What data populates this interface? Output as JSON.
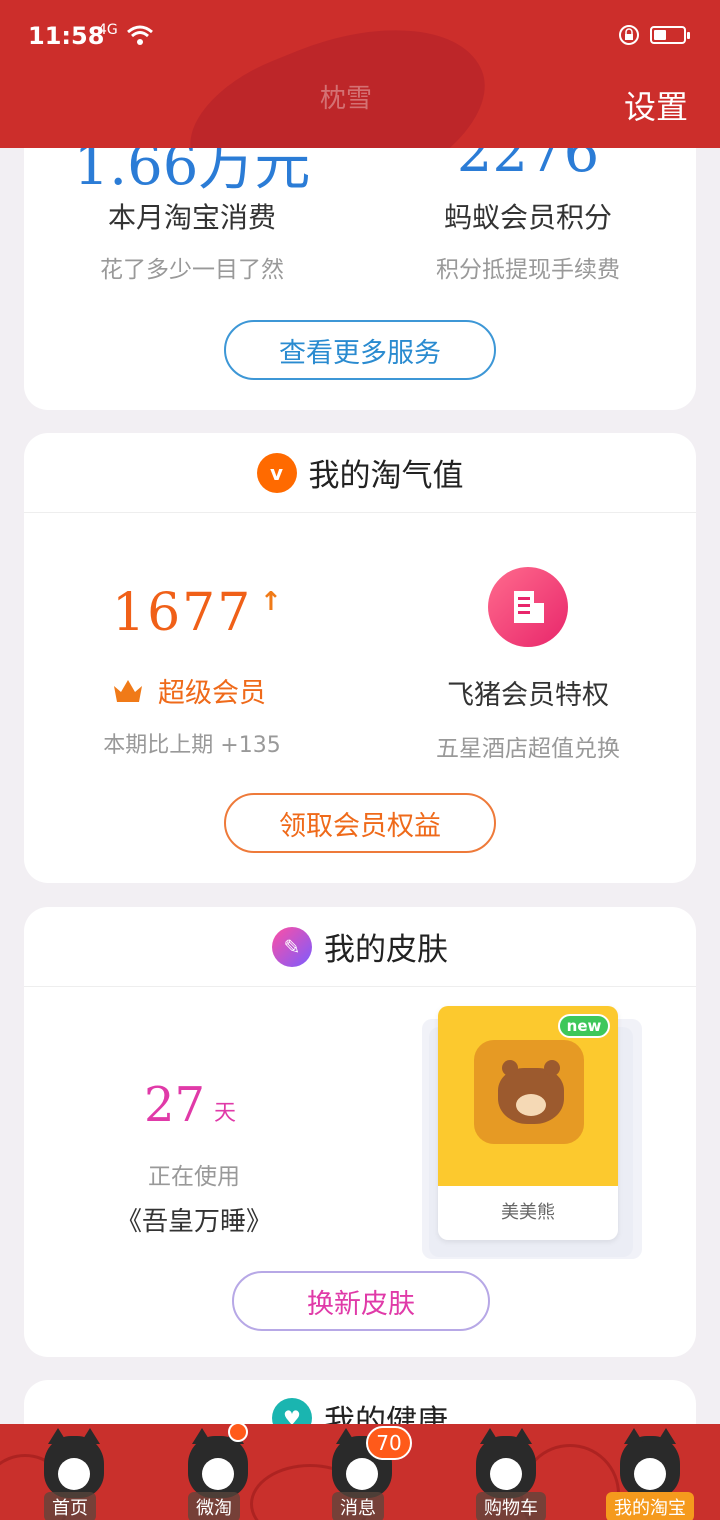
{
  "status_bar": {
    "time": "11:58",
    "network": "4G"
  },
  "header": {
    "settings_label": "设置",
    "user_name": "枕雪"
  },
  "services_card": {
    "left": {
      "value": "1.66万元",
      "title": "本月淘宝消费",
      "subtitle": "花了多少一目了然"
    },
    "right": {
      "value": "2276",
      "title": "蚂蚁会员积分",
      "subtitle": "积分抵提现手续费"
    },
    "more_button": "查看更多服务"
  },
  "taoqi_card": {
    "title": "我的淘气值",
    "icon": "v-icon",
    "score": "1677",
    "level_label": "超级会员",
    "compare_text": "本期比上期 +135",
    "perk_title": "飞猪会员特权",
    "perk_subtitle": "五星酒店超值兑换",
    "claim_button": "领取会员权益",
    "accent_color": "#ef6a1a"
  },
  "skin_card": {
    "title": "我的皮肤",
    "days_value": "27",
    "days_unit": "天",
    "status_label": "正在使用",
    "current_skin": "《吾皇万睡》",
    "preview": {
      "badge": "new",
      "name": "美美熊"
    },
    "change_button": "换新皮肤",
    "accent_color": "#e03aa8"
  },
  "health_card": {
    "title": "我的健康"
  },
  "tabbar": {
    "tabs": [
      {
        "label": "首页",
        "active": false
      },
      {
        "label": "微淘",
        "active": false
      },
      {
        "label": "消息",
        "active": false
      },
      {
        "label": "购物车",
        "active": false
      },
      {
        "label": "我的淘宝",
        "active": true
      }
    ],
    "message_badge": "70"
  }
}
